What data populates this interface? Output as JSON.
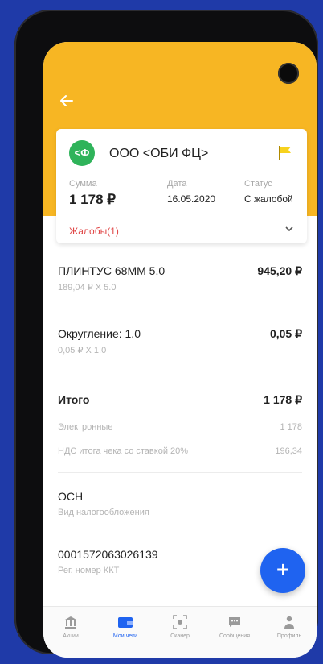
{
  "header": {
    "back_icon": "arrow-left-icon",
    "bg_color": "#f7b623"
  },
  "card": {
    "org_logo_text": "<Ф",
    "org_name": "ООО <ОБИ ФЦ>",
    "flag_icon": "flag-icon",
    "sum_label": "Сумма",
    "sum_value": "1 178 ₽",
    "date_label": "Дата",
    "date_value": "16.05.2020",
    "status_label": "Статус",
    "status_value": "С жалобой",
    "complaints_label": "Жалобы(1)",
    "complaints_color": "#e04848"
  },
  "items": [
    {
      "name": "ПЛИНТУС 68ММ 5.0",
      "sub": "189,04 ₽ X 5.0",
      "amount": "945,20 ₽"
    },
    {
      "name": "Округление: 1.0",
      "sub": "0,05 ₽ X 1.0",
      "amount": "0,05 ₽"
    }
  ],
  "totals": {
    "total_label": "Итого",
    "total_value": "1 178 ₽",
    "electronic_label": "Электронные",
    "electronic_value": "1 178",
    "vat_label": "НДС итога чека со ставкой 20%",
    "vat_value": "196,34"
  },
  "tax": {
    "value": "ОСН",
    "label": "Вид налогообложения"
  },
  "kkt": {
    "value": "0001572063026139",
    "label": "Рег. номер ККТ"
  },
  "fab": {
    "label": "+",
    "color": "#1f63f0"
  },
  "tabbar": {
    "items": [
      {
        "label": "Акции",
        "icon": "bank-icon",
        "active": false
      },
      {
        "label": "Мои чеки",
        "icon": "wallet-icon",
        "active": true
      },
      {
        "label": "Сканер",
        "icon": "scan-icon",
        "active": false
      },
      {
        "label": "Сообщения",
        "icon": "chat-icon",
        "active": false
      },
      {
        "label": "Профиль",
        "icon": "profile-icon",
        "active": false
      }
    ]
  }
}
